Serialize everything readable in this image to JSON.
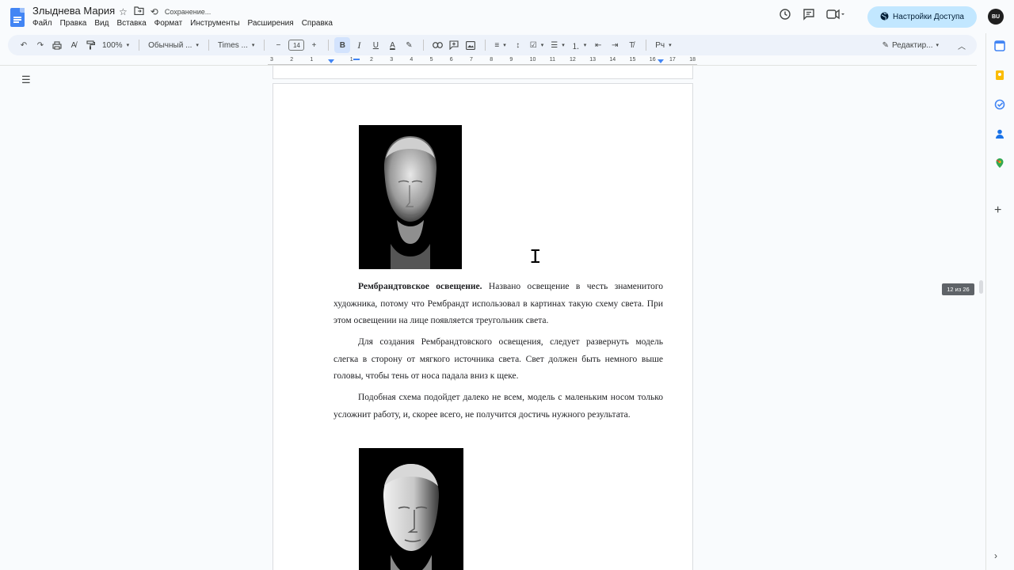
{
  "doc": {
    "title": "Злыднева Мария",
    "status": "Сохранение..."
  },
  "menu": [
    "Файл",
    "Правка",
    "Вид",
    "Вставка",
    "Формат",
    "Инструменты",
    "Расширения",
    "Справка"
  ],
  "share": {
    "label": "Настройки Доступа"
  },
  "avatar": {
    "initials": "BU"
  },
  "toolbar": {
    "zoom": "100%",
    "style": "Обычный ...",
    "font": "Times ...",
    "font_size": "14",
    "editing_mode": "Редактир..."
  },
  "ruler": {
    "ticks": [
      "3",
      "2",
      "1",
      "",
      "1",
      "2",
      "3",
      "4",
      "5",
      "6",
      "7",
      "8",
      "9",
      "10",
      "11",
      "12",
      "13",
      "14",
      "15",
      "16",
      "17",
      "18"
    ]
  },
  "content": {
    "p1_bold": "Рембрандтовское освещение.",
    "p1_rest": " Названо освещение в честь знаменитого художника, потому что Рембрандт использовал в картинах такую схему света. При этом освещении на лице появляется треугольник света.",
    "p2": "Для создания Рембрандтовского освещения, следует развернуть модель слегка в сторону от мягкого источника света. Свет должен быть немного выше головы, чтобы тень от носа падала вниз к щеке.",
    "p3": "Подобная схема подойдет далеко не всем, модель с маленьким носом только усложнит работу, и, скорее всего, не получится достичь нужного результата."
  },
  "page_indicator": "12 из 26",
  "colors": {
    "accent": "#4285f4",
    "share_bg": "#c2e7ff",
    "toolbar_bg": "#edf2fa"
  }
}
